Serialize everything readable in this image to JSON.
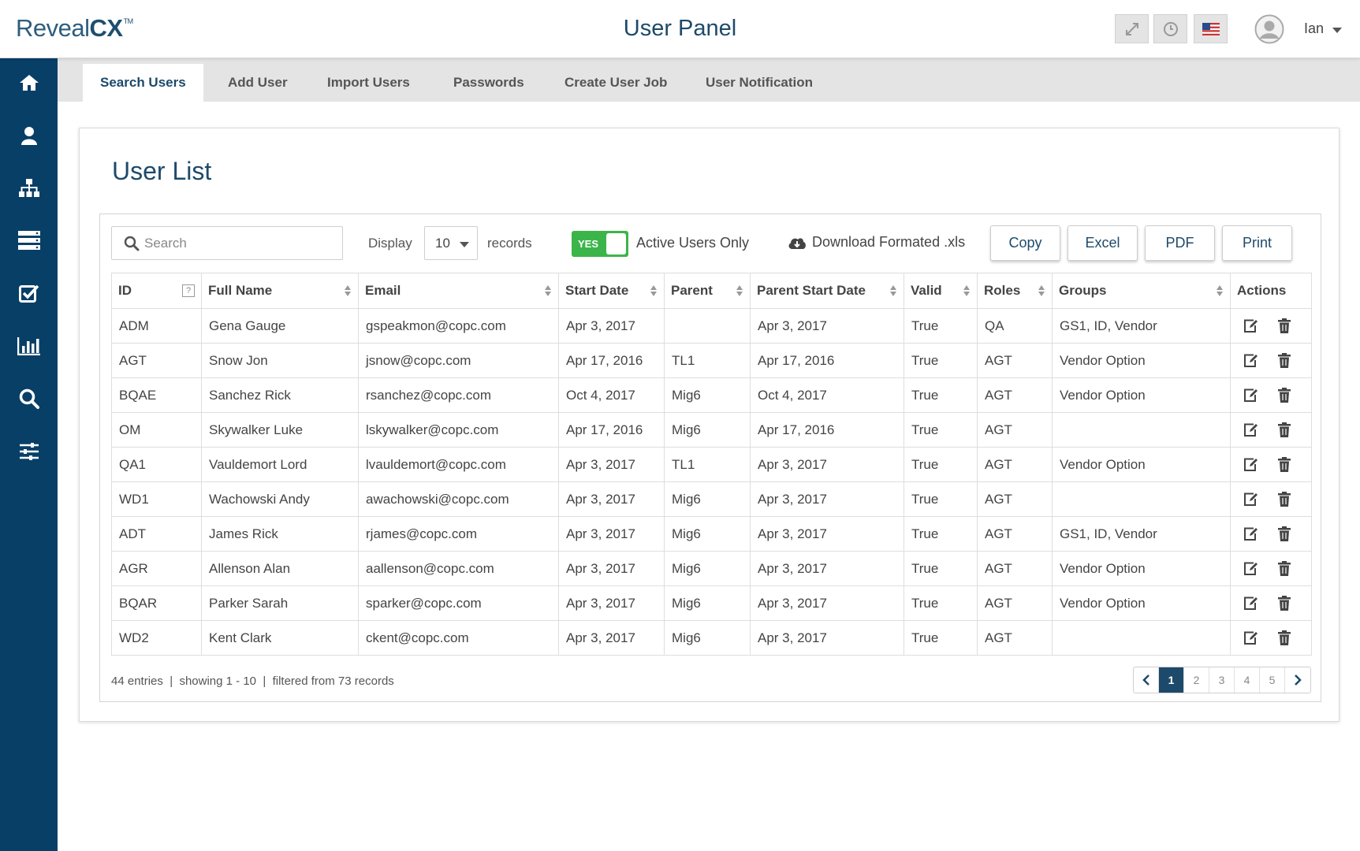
{
  "app": {
    "logo_text": "Reveal",
    "logo_bold": "CX",
    "logo_tm": "TM",
    "title": "User Panel"
  },
  "header": {
    "user_name": "Ian",
    "icons": [
      "expand-icon",
      "clock-icon",
      "flag-icon"
    ]
  },
  "sidebar": {
    "items": [
      "home-icon",
      "user-icon",
      "org-chart-icon",
      "server-icon",
      "checklist-icon",
      "bar-chart-icon",
      "search-icon",
      "sliders-icon"
    ]
  },
  "tabs": [
    {
      "label": "Search Users",
      "active": true
    },
    {
      "label": "Add User",
      "active": false
    },
    {
      "label": "Import Users",
      "active": false
    },
    {
      "label": "Passwords",
      "active": false
    },
    {
      "label": "Create User Job",
      "active": false
    },
    {
      "label": "User Notification",
      "active": false
    }
  ],
  "main": {
    "title": "User List"
  },
  "toolbar": {
    "search_placeholder": "Search",
    "display_label": "Display",
    "display_value": "10",
    "records_label": "records",
    "toggle_label": "YES",
    "active_only_label": "Active Users Only",
    "download_label": "Download Formated .xls",
    "copy_label": "Copy",
    "excel_label": "Excel",
    "pdf_label": "PDF",
    "print_label": "Print"
  },
  "table": {
    "headers": [
      "ID",
      "Full Name",
      "Email",
      "Start Date",
      "Parent",
      "Parent Start Date",
      "Valid",
      "Roles",
      "Groups",
      "Actions"
    ],
    "rows": [
      [
        "ADM",
        "Gena Gauge",
        "gspeakmon@copc.com",
        "Apr 3, 2017",
        "",
        "Apr 3, 2017",
        "True",
        "QA",
        "GS1, ID, Vendor"
      ],
      [
        "AGT",
        "Snow Jon",
        "jsnow@copc.com",
        "Apr 17, 2016",
        "TL1",
        "Apr 17, 2016",
        "True",
        "AGT",
        "Vendor Option"
      ],
      [
        "BQAE",
        "Sanchez Rick",
        "rsanchez@copc.com",
        "Oct 4, 2017",
        "Mig6",
        "Oct 4, 2017",
        "True",
        "AGT",
        "Vendor Option"
      ],
      [
        "OM",
        "Skywalker Luke",
        "lskywalker@copc.com",
        "Apr 17, 2016",
        "Mig6",
        "Apr 17, 2016",
        "True",
        "AGT",
        ""
      ],
      [
        "QA1",
        "Vauldemort Lord",
        "lvauldemort@copc.com",
        "Apr 3, 2017",
        "TL1",
        "Apr 3, 2017",
        "True",
        "AGT",
        "Vendor Option"
      ],
      [
        "WD1",
        "Wachowski Andy",
        "awachowski@copc.com",
        "Apr 3, 2017",
        "Mig6",
        "Apr 3, 2017",
        "True",
        "AGT",
        ""
      ],
      [
        "ADT",
        "James Rick",
        "rjames@copc.com",
        "Apr 3, 2017",
        "Mig6",
        "Apr 3, 2017",
        "True",
        "AGT",
        "GS1, ID, Vendor"
      ],
      [
        "AGR",
        "Allenson Alan",
        "aallenson@copc.com",
        "Apr 3, 2017",
        "Mig6",
        "Apr 3, 2017",
        "True",
        "AGT",
        "Vendor Option"
      ],
      [
        "BQAR",
        "Parker Sarah",
        "sparker@copc.com",
        "Apr 3, 2017",
        "Mig6",
        "Apr 3, 2017",
        "True",
        "AGT",
        "Vendor Option"
      ],
      [
        "WD2",
        "Kent Clark",
        "ckent@copc.com",
        "Apr 3, 2017",
        "Mig6",
        "Apr 3, 2017",
        "True",
        "AGT",
        ""
      ]
    ]
  },
  "footer": {
    "info": "44 entries  |  showing 1 - 10  |  filtered from 73 records",
    "pages": [
      "1",
      "2",
      "3",
      "4",
      "5"
    ],
    "current_page": "1"
  },
  "colors": {
    "brand": "#073f67",
    "accent": "#1d4a6a",
    "toggle_on": "#3bb54a"
  }
}
